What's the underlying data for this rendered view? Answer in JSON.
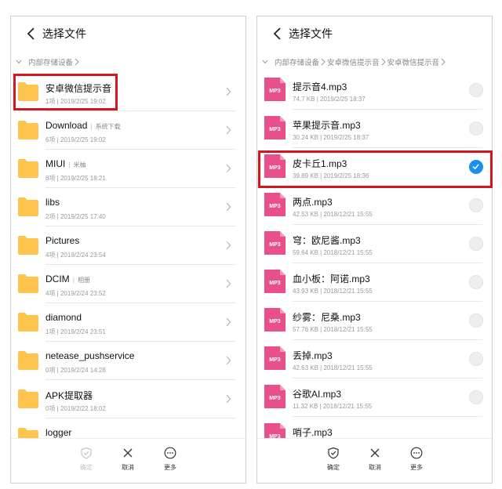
{
  "left_panel": {
    "title": "选择文件",
    "breadcrumbs": [
      "内部存储设备"
    ],
    "items": [
      {
        "name": "安卓微信提示音",
        "tag": "",
        "meta": "1项 | 2019/2/25 19:02"
      },
      {
        "name": "Download",
        "tag": "系统下载",
        "meta": "6项 | 2019/2/25 19:02"
      },
      {
        "name": "MIUI",
        "tag": "米柚",
        "meta": "8项 | 2019/2/25 18:21"
      },
      {
        "name": "libs",
        "tag": "",
        "meta": "2项 | 2019/2/25 17:40"
      },
      {
        "name": "Pictures",
        "tag": "",
        "meta": "4项 | 2019/2/24 23:54"
      },
      {
        "name": "DCIM",
        "tag": "相册",
        "meta": "4项 | 2019/2/24 23:52"
      },
      {
        "name": "diamond",
        "tag": "",
        "meta": "1项 | 2019/2/24 23:51"
      },
      {
        "name": "netease_pushservice",
        "tag": "",
        "meta": "0项 | 2019/2/24 14:28"
      },
      {
        "name": "APK提取器",
        "tag": "",
        "meta": "0项 | 2019/2/22 18:02"
      },
      {
        "name": "logger",
        "tag": "",
        "meta": ""
      }
    ],
    "toolbar": {
      "confirm": "确定",
      "cancel": "取消",
      "more": "更多"
    }
  },
  "right_panel": {
    "title": "选择文件",
    "breadcrumbs": [
      "内部存储设备",
      "安卓微信提示音",
      "安卓微信提示音"
    ],
    "file_badge": "MP3",
    "items": [
      {
        "name": "提示音4.mp3",
        "meta": "74.7 KB | 2019/2/25 18:37",
        "checked": false
      },
      {
        "name": "苹果提示音.mp3",
        "meta": "30.24 KB | 2019/2/25 18:37",
        "checked": false
      },
      {
        "name": "皮卡丘1.mp3",
        "meta": "39.89 KB | 2019/2/25 18:36",
        "checked": true
      },
      {
        "name": "两点.mp3",
        "meta": "42.53 KB | 2018/12/21 15:55",
        "checked": false
      },
      {
        "name": "穹：欧尼酱.mp3",
        "meta": "59.64 KB | 2018/12/21 15:55",
        "checked": false
      },
      {
        "name": "血小板：阿诺.mp3",
        "meta": "43.93 KB | 2018/12/21 15:55",
        "checked": false
      },
      {
        "name": "纱雾：尼桑.mp3",
        "meta": "57.76 KB | 2018/12/21 15:55",
        "checked": false
      },
      {
        "name": "丢掉.mp3",
        "meta": "42.63 KB | 2018/12/21 15:55",
        "checked": false
      },
      {
        "name": "谷歌AI.mp3",
        "meta": "11.32 KB | 2018/12/21 15:55",
        "checked": false
      },
      {
        "name": "哨子.mp3",
        "meta": "",
        "checked": false
      }
    ],
    "toolbar": {
      "confirm": "确定",
      "cancel": "取消",
      "more": "更多"
    }
  },
  "colors": {
    "folder": "#ffc44d",
    "mp3_badge": "#e94f8a",
    "check": "#1b8ff0",
    "highlight": "#d6161e"
  }
}
